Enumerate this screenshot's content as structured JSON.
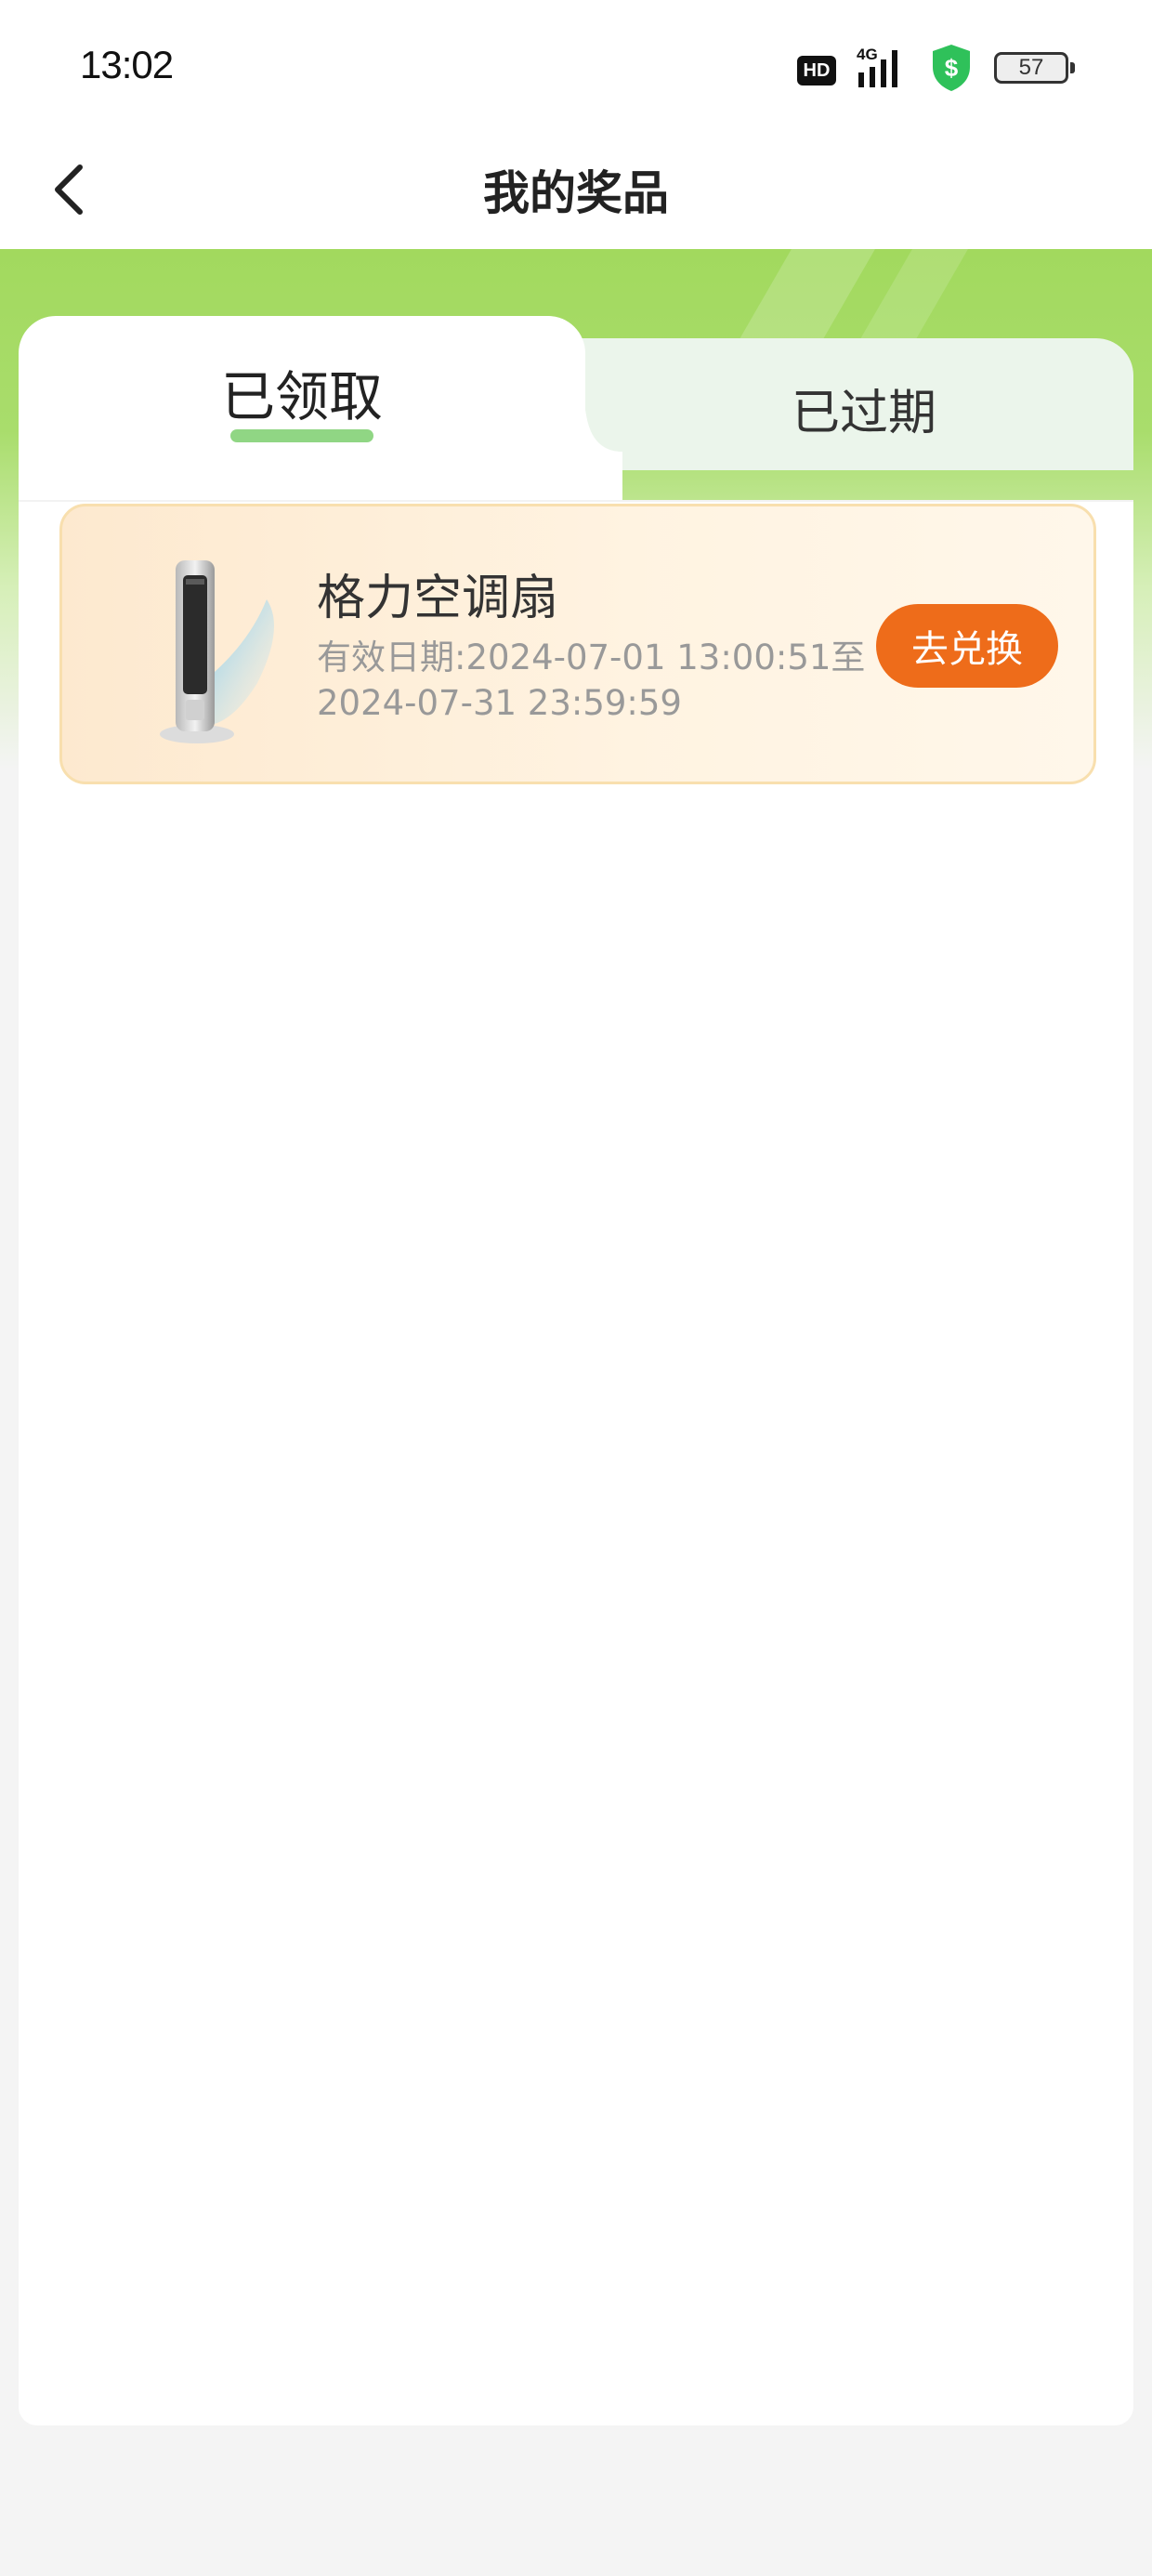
{
  "status_bar": {
    "time": "13:02",
    "hd": "HD",
    "network": "4G",
    "battery": "57",
    "shield_color": "#2fc15a"
  },
  "navbar": {
    "title": "我的奖品",
    "back_icon": "chevron-left-icon"
  },
  "tabs": [
    {
      "label": "已领取",
      "active": true
    },
    {
      "label": "已过期",
      "active": false
    }
  ],
  "prizes": [
    {
      "name": "格力空调扇",
      "validity_line1": "有效日期:2024-07-01 13:00:51至",
      "validity_line2": "2024-07-31 23:59:59",
      "action_label": "去兑换",
      "image": "tower-fan-image"
    }
  ],
  "colors": {
    "header_green": "#a2d95e",
    "tab_inactive_bg": "#ebf5eb",
    "tab_underline": "#7ccf6f",
    "card_border": "#f8dfae",
    "button_orange": "#ee6c1a"
  }
}
